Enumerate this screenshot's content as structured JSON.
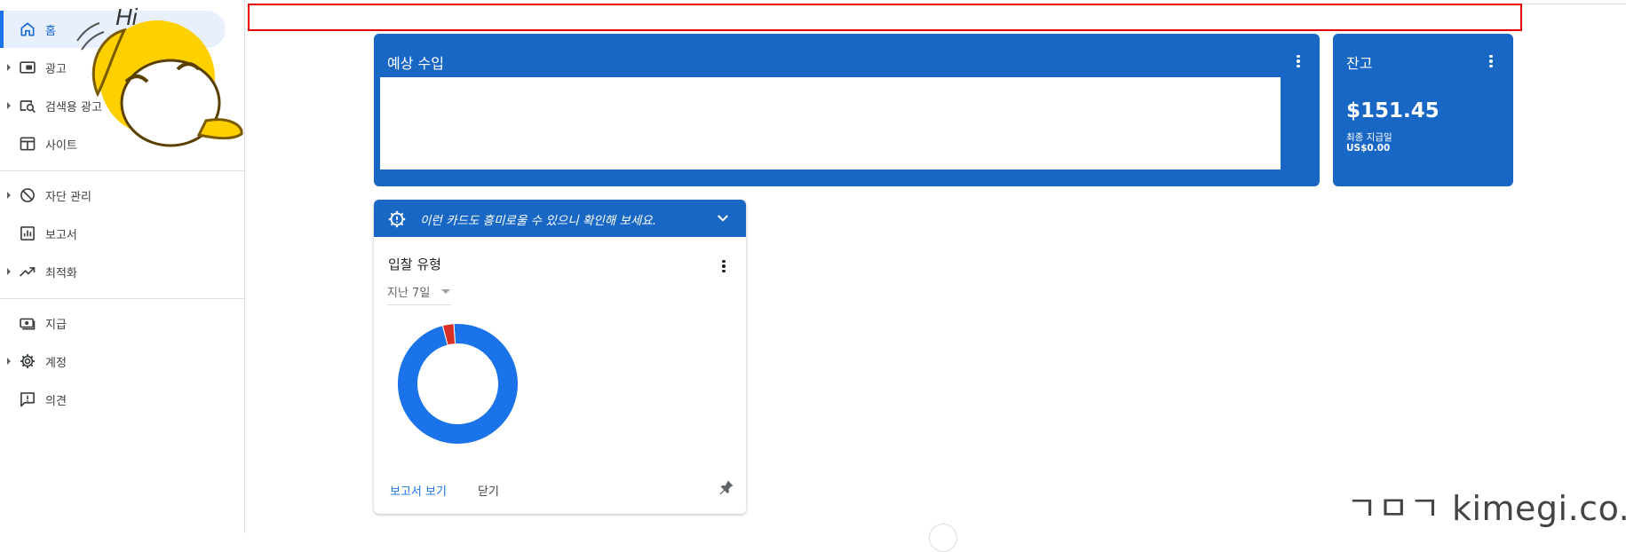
{
  "sidebar": {
    "items": [
      {
        "label": "홈",
        "icon": "home-icon"
      },
      {
        "label": "광고",
        "icon": "ads-icon"
      },
      {
        "label": "검색용 광고",
        "icon": "search-ads-icon"
      },
      {
        "label": "사이트",
        "icon": "sites-icon"
      },
      {
        "label": "자단 관리",
        "icon": "block-icon"
      },
      {
        "label": "보고서",
        "icon": "reports-icon"
      },
      {
        "label": "최적화",
        "icon": "optimization-icon"
      },
      {
        "label": "지급",
        "icon": "payments-icon"
      },
      {
        "label": "계정",
        "icon": "gear-icon"
      },
      {
        "label": "의견",
        "icon": "feedback-icon"
      }
    ]
  },
  "mascot": {
    "text": "Hi"
  },
  "earnings_card": {
    "title": "예상 수입"
  },
  "balance_card": {
    "title": "잔고",
    "amount": "$151.45",
    "last_payment_label": "최종 지급일",
    "last_payment_value": "US$0.00"
  },
  "recommendation_card": {
    "banner_text": "이런 카드도 흥미로울 수 있으니 확인해 보세요.",
    "bid_card": {
      "title": "입찰 유형",
      "period": "지난 7일",
      "report_link": "보고서 보기",
      "close_link": "닫기"
    }
  },
  "chart_data": {
    "type": "pie",
    "slices": [
      {
        "value": 97,
        "color": "#1a73e8"
      },
      {
        "value": 3,
        "color": "#d93025"
      }
    ]
  },
  "watermark": "ㄱㅁㄱ kimegi.co.kr",
  "colors": {
    "accent": "#1867c5",
    "highlight": "#e8000b"
  }
}
